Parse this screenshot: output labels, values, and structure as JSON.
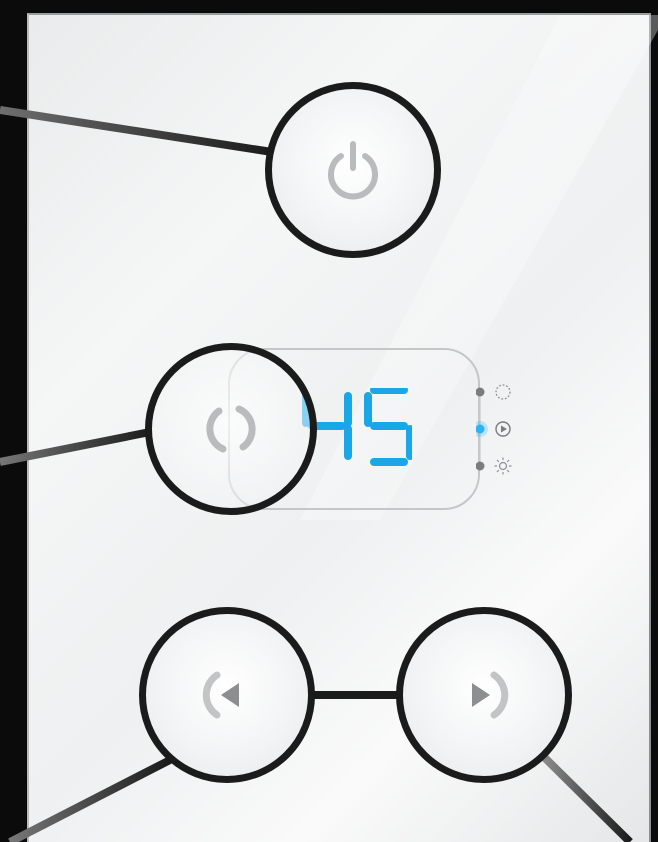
{
  "device": {
    "display": {
      "value": "45",
      "digit_color": "#1aa7e8"
    },
    "buttons": {
      "power": {
        "icon": "power-icon"
      },
      "mode": {
        "icon": "cycle-icon"
      },
      "previous": {
        "icon": "previous-icon"
      },
      "next": {
        "icon": "next-icon"
      }
    },
    "modes": [
      {
        "icon": "dotted-circle-icon",
        "active": false
      },
      {
        "icon": "play-circle-icon",
        "active": true
      },
      {
        "icon": "sun-icon",
        "active": false
      }
    ],
    "colors": {
      "active_indicator": "#2cb4f0",
      "inactive_indicator": "#7a7c7e",
      "icon_gray": "#b9bbbd",
      "outline": "#1b1b1b"
    }
  }
}
